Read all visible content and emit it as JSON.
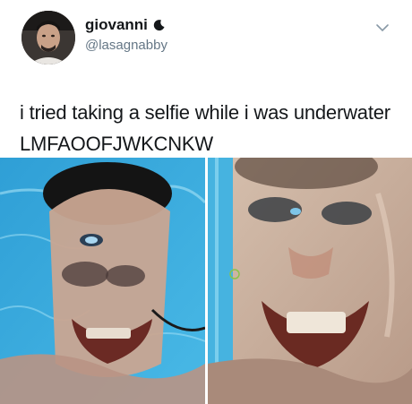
{
  "tweet": {
    "display_name": "giovanni",
    "handle": "@lasagnabby",
    "text": "i tried taking a selfie while i was underwater LMFAOOFJWKCNKW",
    "icons": {
      "verified_like": "crescent-moon-icon",
      "menu": "chevron-down-icon"
    },
    "media": {
      "count": 2
    }
  },
  "colors": {
    "text": "#14171a",
    "handle": "#657786",
    "water": "#3aa7d9"
  }
}
